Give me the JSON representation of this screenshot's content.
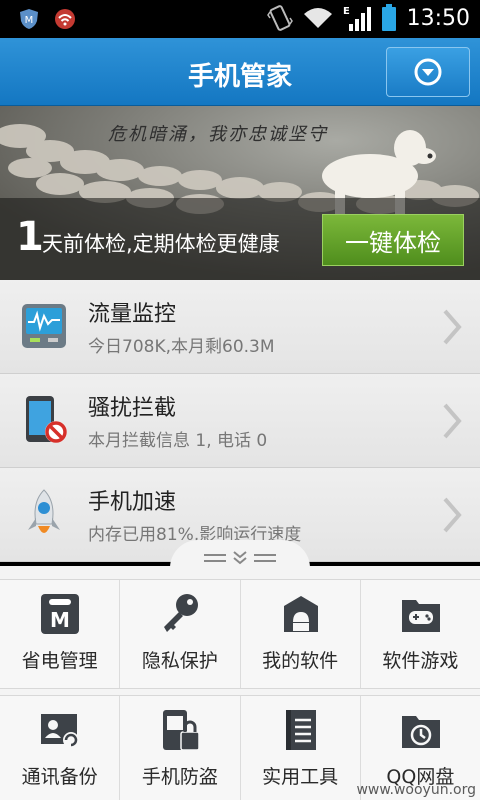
{
  "status_bar": {
    "time": "13:50"
  },
  "header": {
    "title": "手机管家",
    "menu_icon": "chevron-down-circle-icon"
  },
  "banner": {
    "slogan": "危机暗涌，我亦忠诚坚守",
    "days_count": "1",
    "message": "天前体检,定期体检更健康",
    "button_label": "一键体检",
    "button_color": "#5f9f2a"
  },
  "list": [
    {
      "title": "流量监控",
      "subtitle": "今日708K,本月剩60.3M",
      "icon": "traffic-monitor-icon"
    },
    {
      "title": "骚扰拦截",
      "subtitle": "本月拦截信息 1, 电话 0",
      "icon": "block-call-icon"
    },
    {
      "title": "手机加速",
      "subtitle": "内存已用81%,影响运行速度",
      "icon": "rocket-icon"
    }
  ],
  "tools": [
    {
      "label": "省电管理",
      "icon": "battery-saver-icon"
    },
    {
      "label": "隐私保护",
      "icon": "key-icon"
    },
    {
      "label": "我的软件",
      "icon": "android-box-icon"
    },
    {
      "label": "软件游戏",
      "icon": "gamepad-folder-icon"
    },
    {
      "label": "通讯备份",
      "icon": "contact-backup-icon"
    },
    {
      "label": "手机防盗",
      "icon": "phone-lock-icon"
    },
    {
      "label": "实用工具",
      "icon": "notebook-icon"
    },
    {
      "label": "QQ网盘",
      "icon": "cloud-folder-icon"
    }
  ],
  "watermark": "www.wooyun.org",
  "colors": {
    "header": "#1f86cf",
    "list_bg": "#e9e9e9",
    "accent_green": "#5f9f2a"
  }
}
